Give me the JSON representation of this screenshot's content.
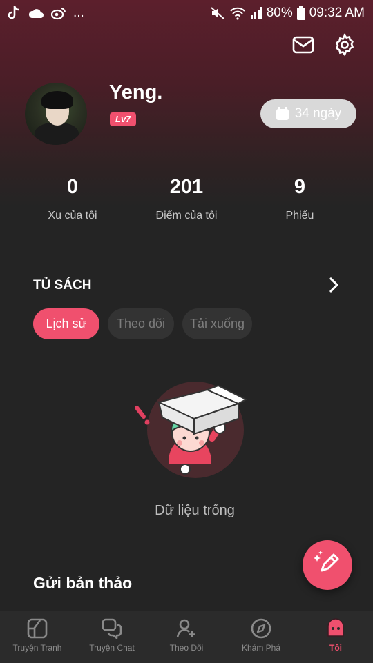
{
  "status_bar": {
    "left_icons": [
      "tiktok-icon",
      "cloud-icon",
      "weibo-icon"
    ],
    "more": "...",
    "battery": "80%",
    "time": "09:32 AM"
  },
  "header": {
    "icons": [
      "mail-icon",
      "settings-icon"
    ]
  },
  "profile": {
    "username": "Yeng.",
    "level": "Lv7",
    "days_label": "34 ngày"
  },
  "stats": [
    {
      "value": "0",
      "label": "Xu của tôi"
    },
    {
      "value": "201",
      "label": "Điểm của tôi"
    },
    {
      "value": "9",
      "label": "Phiếu"
    }
  ],
  "bookshelf": {
    "title": "TỦ SÁCH",
    "tabs": [
      {
        "label": "Lịch sử",
        "active": true
      },
      {
        "label": "Theo dõi",
        "active": false
      },
      {
        "label": "Tải xuống",
        "active": false
      }
    ],
    "empty_text": "Dữ liệu trống"
  },
  "submit": {
    "label": "Gửi bản thảo"
  },
  "colors": {
    "accent": "#f0506e",
    "background": "#242424",
    "header_gradient_top": "#5c1f2c",
    "nav_background": "#2b2b2b"
  },
  "bottom_nav": [
    {
      "label": "Truyện Tranh",
      "icon": "comic-icon",
      "active": false
    },
    {
      "label": "Truyện Chat",
      "icon": "chat-icon",
      "active": false
    },
    {
      "label": "Theo Dõi",
      "icon": "follow-icon",
      "active": false
    },
    {
      "label": "Khám Phá",
      "icon": "compass-icon",
      "active": false
    },
    {
      "label": "Tôi",
      "icon": "me-icon",
      "active": true
    }
  ]
}
